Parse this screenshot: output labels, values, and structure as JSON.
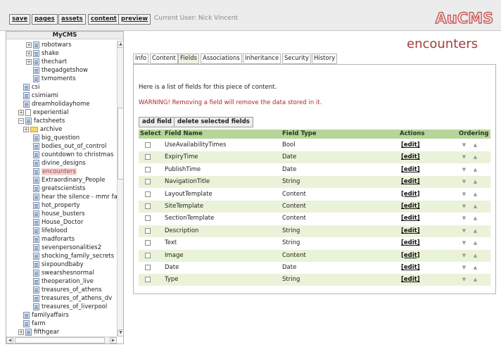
{
  "toolbar": {
    "buttons": [
      "save",
      "pages",
      "assets",
      "content",
      "preview"
    ],
    "current_user": "Current User: Nick Vincent",
    "logo": "AuCMS"
  },
  "sidebar": {
    "title": "MyCMS",
    "tree": [
      {
        "label": "robotwars",
        "icon": "document-icon",
        "expander": "+"
      },
      {
        "label": "shake",
        "icon": "document-icon",
        "expander": "+"
      },
      {
        "label": "thechart",
        "icon": "document-icon",
        "expander": "+"
      },
      {
        "label": "thegadgetshow",
        "icon": "document-icon"
      },
      {
        "label": "tvmoments",
        "icon": "document-icon"
      },
      {
        "label": "csi",
        "icon": "document-icon"
      },
      {
        "label": "csimiami",
        "icon": "document-icon"
      },
      {
        "label": "dreamholidayhome",
        "icon": "document-icon"
      },
      {
        "label": "experiential",
        "icon": "page-icon",
        "expander": "+"
      },
      {
        "label": "factsheets",
        "icon": "document-icon",
        "expander": "−"
      },
      {
        "label": "archive",
        "icon": "folder-icon",
        "expander": "+"
      },
      {
        "label": "big_question",
        "icon": "document-icon"
      },
      {
        "label": "bodies_out_of_control",
        "icon": "document-icon"
      },
      {
        "label": "countdown to christmas",
        "icon": "document-icon"
      },
      {
        "label": "divine_designs",
        "icon": "document-icon"
      },
      {
        "label": "encounters",
        "icon": "document-icon",
        "selected": true
      },
      {
        "label": "Extraordinary_People",
        "icon": "document-icon"
      },
      {
        "label": "greatscientists",
        "icon": "document-icon"
      },
      {
        "label": "hear the silence - mmr fa",
        "icon": "document-icon"
      },
      {
        "label": "hot_property",
        "icon": "document-icon"
      },
      {
        "label": "house_busters",
        "icon": "document-icon"
      },
      {
        "label": "House_Doctor",
        "icon": "document-icon"
      },
      {
        "label": "lifeblood",
        "icon": "document-icon"
      },
      {
        "label": "madforarts",
        "icon": "document-icon"
      },
      {
        "label": "sevenpersonalities2",
        "icon": "document-icon"
      },
      {
        "label": "shocking_family_secrets",
        "icon": "document-icon"
      },
      {
        "label": "sixpoundbaby",
        "icon": "document-icon"
      },
      {
        "label": "swearshesnormal",
        "icon": "document-icon"
      },
      {
        "label": "theoperation_live",
        "icon": "document-icon"
      },
      {
        "label": "treasures_of_athens",
        "icon": "document-icon"
      },
      {
        "label": "treasures_of_athens_dv",
        "icon": "document-icon"
      },
      {
        "label": "treasures_of_liverpool",
        "icon": "document-icon"
      },
      {
        "label": "familyaffairs",
        "icon": "document-icon"
      },
      {
        "label": "farm",
        "icon": "document-icon"
      },
      {
        "label": "fifthgear",
        "icon": "document-icon",
        "expander": "+"
      }
    ]
  },
  "main": {
    "title": "encounters",
    "tabs": [
      "Info",
      "Content",
      "Fields",
      "Associations",
      "Inheritance",
      "Security",
      "History"
    ],
    "active_tab": "Fields",
    "intro": "Here is a list of fields for this piece of content.",
    "warning": "WARNING! Removing a field will remove the data stored in it.",
    "buttons": {
      "add": "add field",
      "delete": "delete selected fields"
    },
    "table": {
      "headers": [
        "Select",
        "Field Name",
        "Field Type",
        "Actions",
        "Ordering"
      ],
      "rows": [
        {
          "name": "UseAvailabilityTimes",
          "type": "Bool",
          "action": "[edit]"
        },
        {
          "name": "ExpiryTime",
          "type": "Date",
          "action": "[edit]"
        },
        {
          "name": "PublishTime",
          "type": "Date",
          "action": "[edit]"
        },
        {
          "name": "NavigationTitle",
          "type": "String",
          "action": "[edit]"
        },
        {
          "name": "LayoutTemplate",
          "type": "Content",
          "action": "[edit]"
        },
        {
          "name": "SiteTemplate",
          "type": "Content",
          "action": "[edit]"
        },
        {
          "name": "SectionTemplate",
          "type": "Content",
          "action": "[edit]"
        },
        {
          "name": "Description",
          "type": "String",
          "action": "[edit]"
        },
        {
          "name": "Text",
          "type": "String",
          "action": "[edit]"
        },
        {
          "name": "Image",
          "type": "Content",
          "action": "[edit]"
        },
        {
          "name": "Date",
          "type": "Date",
          "action": "[edit]"
        },
        {
          "name": "Type",
          "type": "String",
          "action": "[edit]"
        }
      ]
    }
  },
  "colors": {
    "accent": "#a53c3c",
    "table_header": "#b9d49a",
    "row_alt": "#eaf3d9",
    "warning": "#b0262a"
  }
}
